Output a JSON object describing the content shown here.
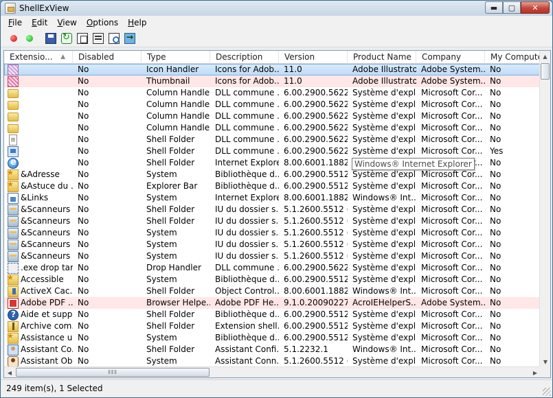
{
  "window": {
    "title": "ShellExView",
    "buttons": {
      "minimize": "▬",
      "maximize": "▢",
      "close": "✕"
    }
  },
  "menu": [
    {
      "label": "File",
      "accel": "F",
      "rest": "ile"
    },
    {
      "label": "Edit",
      "accel": "E",
      "rest": "dit"
    },
    {
      "label": "View",
      "accel": "V",
      "rest": "iew"
    },
    {
      "label": "Options",
      "accel": "O",
      "rest": "ptions"
    },
    {
      "label": "Help",
      "accel": "H",
      "rest": "elp"
    }
  ],
  "toolbar": {
    "buttons": [
      {
        "name": "disable-selected-button",
        "icon": "red-dot-icon"
      },
      {
        "name": "enable-selected-button",
        "icon": "green-dot-icon"
      },
      {
        "name": "save-button",
        "icon": "save-icon"
      },
      {
        "name": "refresh-button",
        "icon": "refresh-icon"
      },
      {
        "name": "copy-button",
        "icon": "copy-icon"
      },
      {
        "name": "properties-button",
        "icon": "properties-icon"
      },
      {
        "name": "find-button",
        "icon": "find-icon"
      },
      {
        "name": "exit-button",
        "icon": "exit-icon"
      }
    ]
  },
  "columns": [
    {
      "label": "Extensio...",
      "sort": "▲"
    },
    {
      "label": "Disabled"
    },
    {
      "label": "Type"
    },
    {
      "label": "Description"
    },
    {
      "label": "Version"
    },
    {
      "label": "Product Name"
    },
    {
      "label": "Company"
    },
    {
      "label": "My Compute"
    }
  ],
  "rows": [
    {
      "icon": "ai",
      "name": "",
      "disabled": "No",
      "type": "Icon Handler",
      "desc": "Icons for Adob...",
      "version": "11.0",
      "product": "Adobe Illustrator",
      "company": "Adobe System...",
      "mycomp": "No",
      "state": "selected"
    },
    {
      "icon": "ai-pink",
      "name": "",
      "disabled": "No",
      "type": "Thumbnail",
      "desc": "Icons for Adob...",
      "version": "11.0",
      "product": "Adobe Illustrator",
      "company": "Adobe System...",
      "mycomp": "No",
      "state": "pink"
    },
    {
      "icon": "folder",
      "name": "",
      "disabled": "No",
      "type": "Column Handler",
      "desc": "DLL commune ...",
      "version": "6.00.2900.5622 ...",
      "product": "Système d'expl...",
      "company": "Microsoft Cor...",
      "mycomp": "No",
      "state": ""
    },
    {
      "icon": "folder",
      "name": "",
      "disabled": "No",
      "type": "Column Handler",
      "desc": "DLL commune ...",
      "version": "6.00.2900.5622 ...",
      "product": "Système d'expl...",
      "company": "Microsoft Cor...",
      "mycomp": "No",
      "state": ""
    },
    {
      "icon": "folder",
      "name": "",
      "disabled": "No",
      "type": "Column Handler",
      "desc": "DLL commune ...",
      "version": "6.00.2900.5622 ...",
      "product": "Système d'expl...",
      "company": "Microsoft Cor...",
      "mycomp": "No",
      "state": ""
    },
    {
      "icon": "folder",
      "name": "",
      "disabled": "No",
      "type": "Column Handler",
      "desc": "DLL commune ...",
      "version": "6.00.2900.5622 ...",
      "product": "Système d'expl...",
      "company": "Microsoft Cor...",
      "mycomp": "No",
      "state": ""
    },
    {
      "icon": "page",
      "name": "",
      "disabled": "No",
      "type": "Shell Folder",
      "desc": "DLL commune ...",
      "version": "6.00.2900.5622 ...",
      "product": "Système d'expl...",
      "company": "Microsoft Cor...",
      "mycomp": "No",
      "state": ""
    },
    {
      "icon": "monitor",
      "name": "",
      "disabled": "No",
      "type": "Shell Folder",
      "desc": "DLL commune ...",
      "version": "6.00.2900.5622 ...",
      "product": "Système d'expl...",
      "company": "Microsoft Cor...",
      "mycomp": "Yes",
      "state": ""
    },
    {
      "icon": "ie",
      "name": "",
      "disabled": "No",
      "type": "Shell Folder",
      "desc": "Internet Explorer",
      "version": "8.00.6001.1882...",
      "product": "Windows® Int...",
      "company": "Microsoft Cor...",
      "mycomp": "No",
      "state": ""
    },
    {
      "icon": "star-folder",
      "name": "&Adresse",
      "disabled": "No",
      "type": "System",
      "desc": "Bibliothèque d...",
      "version": "6.00.2900.5512 ...",
      "product": "Système d'expl...",
      "company": "Microsoft Cor...",
      "mycomp": "No",
      "state": ""
    },
    {
      "icon": "star-folder",
      "name": "&Astuce du ...",
      "disabled": "No",
      "type": "Explorer Bar",
      "desc": "Bibliothèque d...",
      "version": "6.00.2900.5512 ...",
      "product": "Système d'expl...",
      "company": "Microsoft Cor...",
      "mycomp": "No",
      "state": ""
    },
    {
      "icon": "house",
      "name": "&Links",
      "disabled": "No",
      "type": "System",
      "desc": "Internet Explorer",
      "version": "8.00.6001.1882...",
      "product": "Windows® Int...",
      "company": "Microsoft Cor...",
      "mycomp": "No",
      "state": ""
    },
    {
      "icon": "scanner",
      "name": "&Scanneurs ...",
      "disabled": "No",
      "type": "Shell Folder",
      "desc": "IU du dossier s...",
      "version": "5.1.2600.5512 (...",
      "product": "Système d'expl...",
      "company": "Microsoft Cor...",
      "mycomp": "No",
      "state": ""
    },
    {
      "icon": "scanner",
      "name": "&Scanneurs ...",
      "disabled": "No",
      "type": "Shell Folder",
      "desc": "IU du dossier s...",
      "version": "5.1.2600.5512 (...",
      "product": "Système d'expl...",
      "company": "Microsoft Cor...",
      "mycomp": "No",
      "state": ""
    },
    {
      "icon": "scanner",
      "name": "&Scanneurs ...",
      "disabled": "No",
      "type": "System",
      "desc": "IU du dossier s...",
      "version": "5.1.2600.5512 (...",
      "product": "Système d'expl...",
      "company": "Microsoft Cor...",
      "mycomp": "No",
      "state": ""
    },
    {
      "icon": "scanner",
      "name": "&Scanneurs ...",
      "disabled": "No",
      "type": "System",
      "desc": "IU du dossier s...",
      "version": "5.1.2600.5512 (...",
      "product": "Système d'expl...",
      "company": "Microsoft Cor...",
      "mycomp": "No",
      "state": ""
    },
    {
      "icon": "scanner",
      "name": "&Scanneurs ...",
      "disabled": "No",
      "type": "System",
      "desc": "IU du dossier s...",
      "version": "5.1.2600.5512 (...",
      "product": "Système d'expl...",
      "company": "Microsoft Cor...",
      "mycomp": "No",
      "state": ""
    },
    {
      "icon": "drop",
      "name": ".exe drop tar...",
      "disabled": "No",
      "type": "Drop Handler",
      "desc": "DLL commune ...",
      "version": "6.00.2900.5622 ...",
      "product": "Système d'expl...",
      "company": "Microsoft Cor...",
      "mycomp": "No",
      "state": ""
    },
    {
      "icon": "star-folder",
      "name": "Accessible",
      "disabled": "No",
      "type": "System",
      "desc": "Bibliothèque d...",
      "version": "6.00.2900.5512 ...",
      "product": "Système d'expl...",
      "company": "Microsoft Cor...",
      "mycomp": "No",
      "state": ""
    },
    {
      "icon": "activex",
      "name": "ActiveX Cac...",
      "disabled": "No",
      "type": "Shell Folder",
      "desc": "Object Control...",
      "version": "8.00.6001.1882...",
      "product": "Windows® Int...",
      "company": "Microsoft Cor...",
      "mycomp": "No",
      "state": ""
    },
    {
      "icon": "pdf",
      "name": "Adobe PDF ...",
      "disabled": "No",
      "type": "Browser Helpe...",
      "desc": "Adobe PDF He...",
      "version": "9.1.0.2009022700",
      "product": "AcroIEHelperS...",
      "company": "Adobe System...",
      "mycomp": "No",
      "state": "pink"
    },
    {
      "icon": "help",
      "name": "Aide et supp...",
      "disabled": "No",
      "type": "Shell Folder",
      "desc": "Bibliothèque d...",
      "version": "6.00.2900.5512 ...",
      "product": "Système d'expl...",
      "company": "Microsoft Cor...",
      "mycomp": "No",
      "state": ""
    },
    {
      "icon": "archive",
      "name": "Archive com...",
      "disabled": "No",
      "type": "Shell Folder",
      "desc": "Extension shell...",
      "version": "6.00.2900.5512 ...",
      "product": "Système d'expl...",
      "company": "Microsoft Cor...",
      "mycomp": "No",
      "state": ""
    },
    {
      "icon": "star-folder",
      "name": "Assistance u...",
      "disabled": "No",
      "type": "System",
      "desc": "Bibliothèque d...",
      "version": "6.00.2900.5512 ...",
      "product": "Système d'expl...",
      "company": "Microsoft Cor...",
      "mycomp": "No",
      "state": ""
    },
    {
      "icon": "wizard",
      "name": "Assistant Co...",
      "disabled": "No",
      "type": "Shell Folder",
      "desc": "Assistant Confi...",
      "version": "5.1.2232.1",
      "product": "Windows® Int...",
      "company": "Microsoft Cor...",
      "mycomp": "No",
      "state": ""
    },
    {
      "icon": "person",
      "name": "Assistant Ob...",
      "disabled": "No",
      "type": "System",
      "desc": "Assistant Conn...",
      "version": "5.1.2600.5512 (...",
      "product": "Système d'expl...",
      "company": "Microsoft Cor...",
      "mycomp": "No",
      "state": ""
    }
  ],
  "tooltip": {
    "text": "Windows® Internet Explorer"
  },
  "scroll": {
    "hthumb_grip": "⦀⦀⦀"
  },
  "status": {
    "text": "249 item(s), 1 Selected"
  },
  "colors": {
    "selected_row": "#c9e3fb",
    "pink_row": "#ffe7e7",
    "window_border": "#3c6a8c"
  }
}
